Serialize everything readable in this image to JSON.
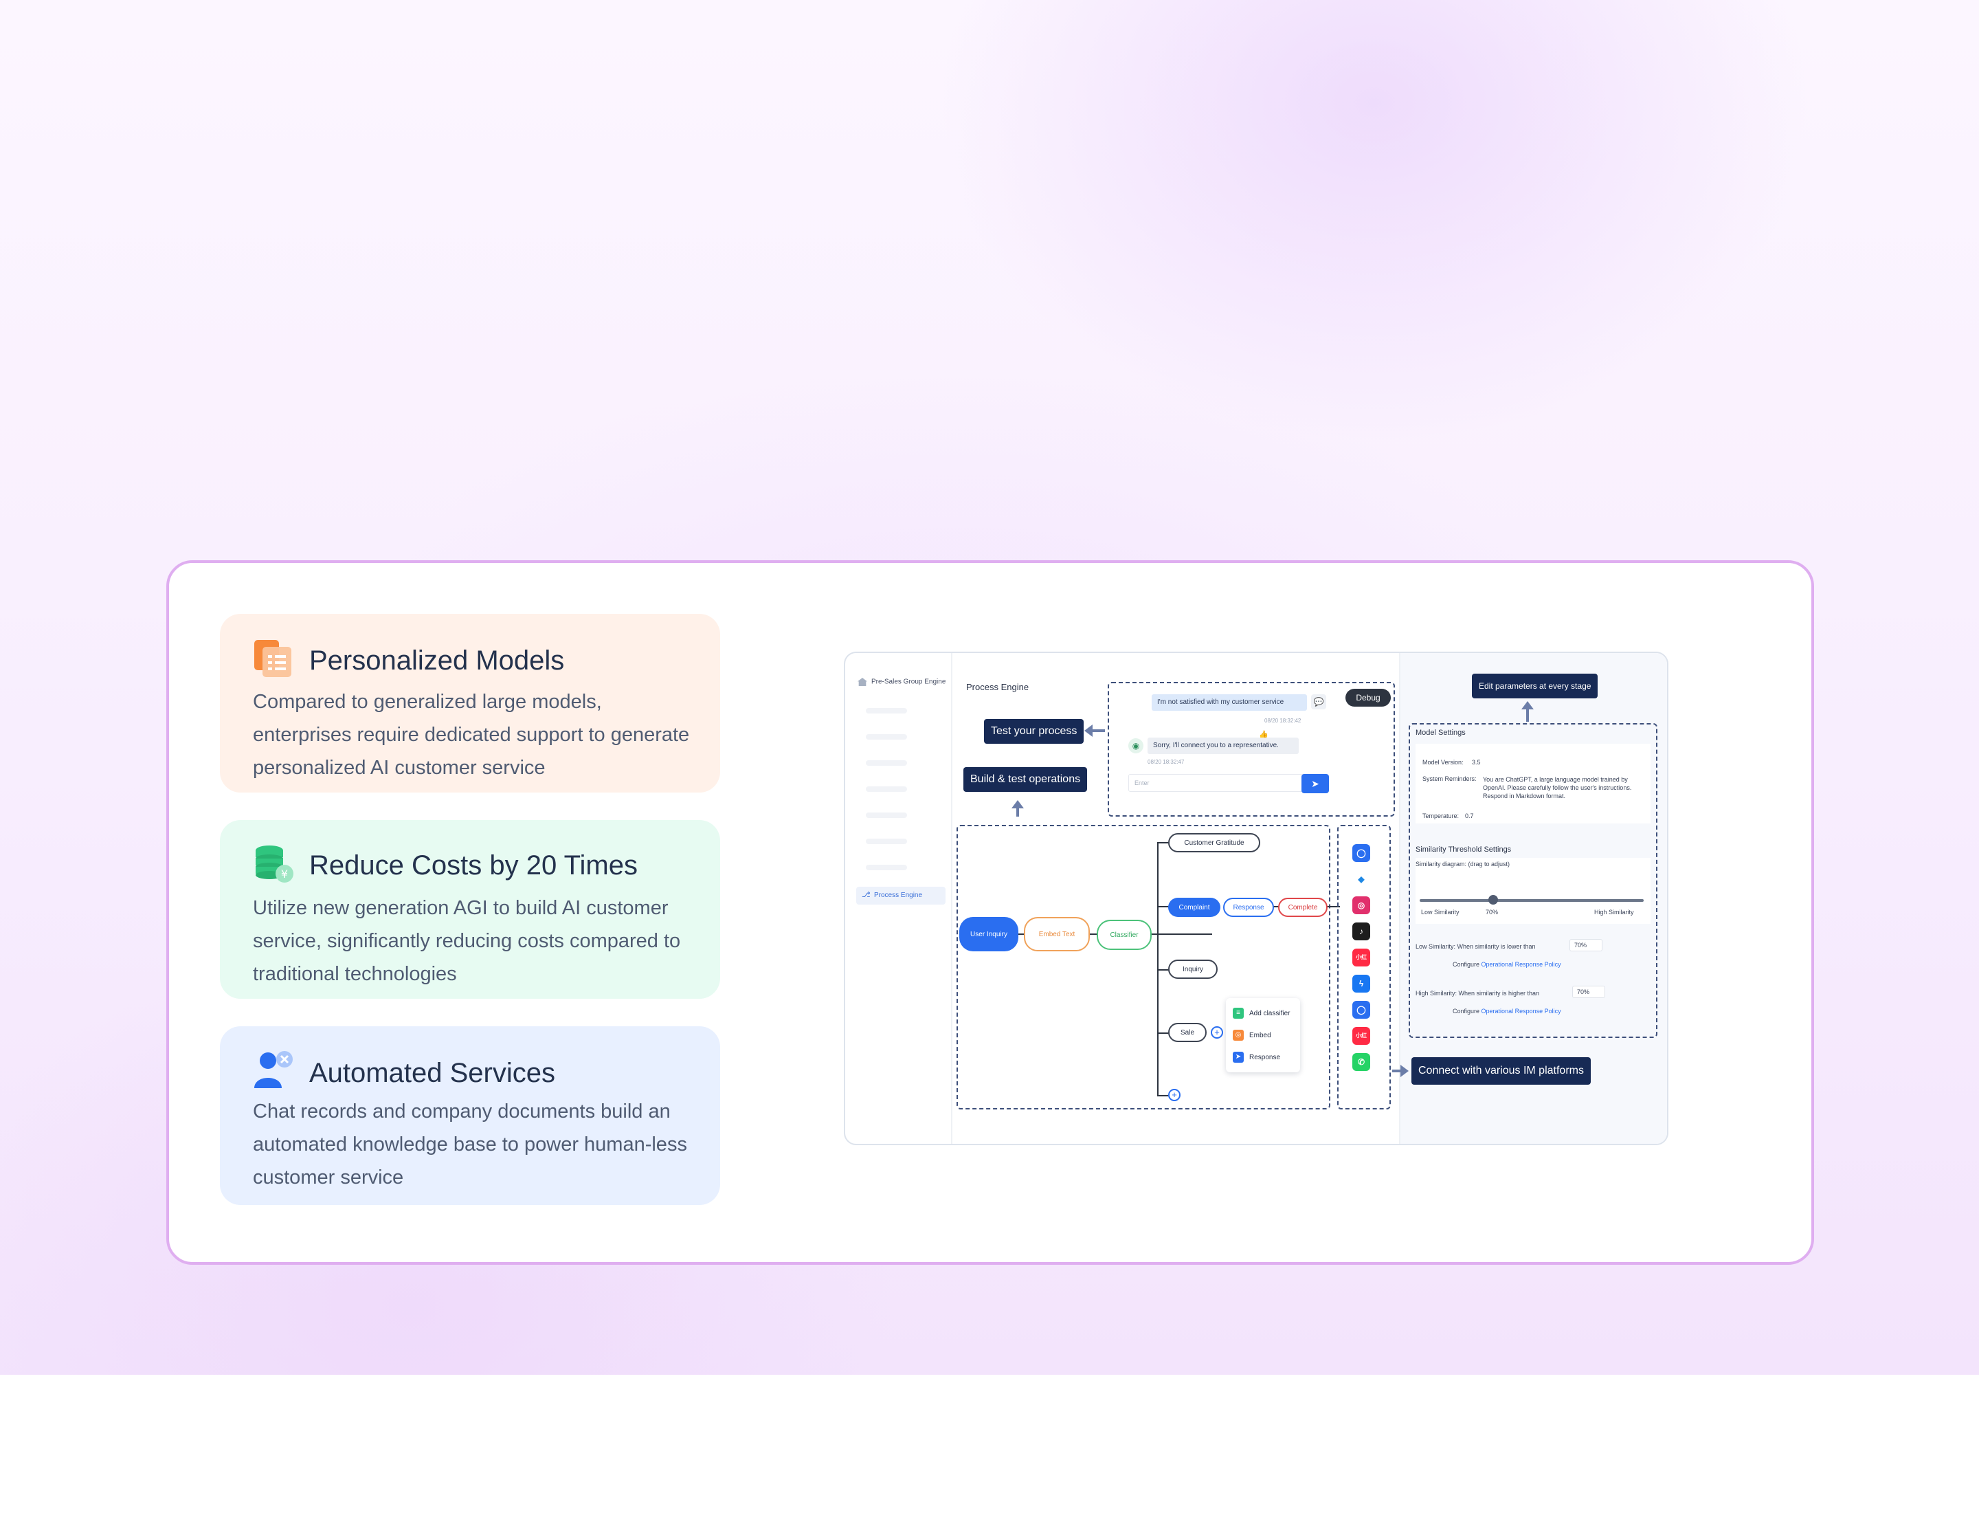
{
  "features": [
    {
      "title": "Personalized Models",
      "description": "Compared to generalized large models, enterprises require dedicated support to generate personalized AI customer service",
      "icon": "document-list-icon",
      "color": "#f7893a"
    },
    {
      "title": "Reduce Costs by 20 Times",
      "description": "Utilize new generation AGI to build AI customer service, significantly reducing costs compared to traditional technologies",
      "icon": "coin-stack-icon",
      "color": "#2fc57e"
    },
    {
      "title": "Automated Services",
      "description": "Chat records and company documents build an automated knowledge base to power human-less customer service",
      "icon": "user-automation-icon",
      "color": "#2a6ef0"
    }
  ],
  "mockup": {
    "sidebar": {
      "group": "Pre-Sales Group Engine",
      "active_item": "Process Engine"
    },
    "main_title": "Process Engine",
    "callouts": {
      "test": "Test your process",
      "build": "Build & test operations",
      "edit": "Edit parameters at every stage",
      "connect": "Connect with various IM platforms"
    },
    "chat": {
      "user_message": "I'm not satisfied with my customer service",
      "user_time": "08/20 18:32:42",
      "bot_message": "Sorry, I'll connect you to a representative.",
      "bot_time": "08/20 18:32:47",
      "input_placeholder": "Enter",
      "debug_label": "Debug"
    },
    "flow": {
      "user_inquiry": "User Inquiry",
      "embed_text": "Embed Text",
      "classifier": "Classifier",
      "customer_gratitude": "Customer Gratitude",
      "complaint": "Complaint",
      "response": "Response",
      "complete": "Complete",
      "inquiry": "Inquiry",
      "sale": "Sale",
      "menu": [
        "Add classifier",
        "Embed",
        "Response"
      ]
    },
    "im_platforms": [
      "chat-bubble-icon",
      "bird-icon",
      "instagram-icon",
      "tiktok-icon",
      "red-app-icon",
      "messenger-icon",
      "chat-bubble-icon",
      "red-app-icon",
      "whatsapp-icon"
    ],
    "model_settings": {
      "title": "Model Settings",
      "model_version_label": "Model Version:",
      "model_version": "3.5",
      "system_reminders_label": "System Reminders:",
      "system_reminders": "You are ChatGPT, a large language model trained by OpenAI. Please carefully follow the user's instructions. Respond in Markdown format.",
      "temperature_label": "Temperature:",
      "temperature": "0.7",
      "similarity_title": "Similarity Threshold Settings",
      "similarity_hint": "Similarity diagram: (drag to adjust)",
      "low_label": "Low Similarity",
      "value_label": "70%",
      "slider_value": 0.3,
      "high_label": "High Similarity",
      "low_rule": "Low Similarity: When similarity is lower than",
      "low_value": "70%",
      "high_rule": "High Similarity: When similarity is higher than",
      "high_value": "70%",
      "configure": "Configure",
      "policy_link": "Operational Response Policy"
    }
  }
}
